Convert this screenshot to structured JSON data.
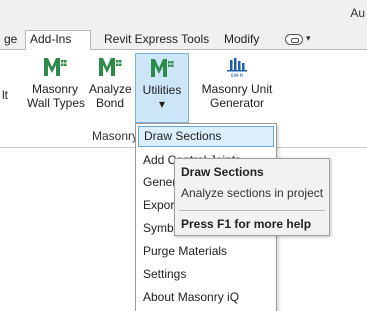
{
  "window": {
    "title": "Au"
  },
  "tabs": [
    "ge",
    "Add-Ins",
    "Revit Express Tools",
    "Modify"
  ],
  "tab_active_index": 1,
  "ribbon": {
    "left_stub": "lt",
    "buttons": [
      {
        "line1": "Masonry",
        "line2": "Wall Types",
        "icon": "masonry-iq-logo-icon"
      },
      {
        "line1": "Analyze",
        "line2": "Bond",
        "icon": "masonry-iq-logo-icon"
      },
      {
        "line1": "Utilities",
        "line2": "▾",
        "icon": "masonry-iq-logo-icon"
      },
      {
        "line1": "Masonry Unit",
        "line2": "Generator",
        "icon": "bim-m-icon"
      }
    ],
    "panel_label": "Masonry iQ",
    "bim_badge": "BIM-M"
  },
  "menu": {
    "items": [
      "Draw Sections",
      "Add Control Joints",
      "General",
      "Export",
      "Symbols",
      "Purge Materials",
      "Settings",
      "About Masonry iQ"
    ],
    "highlighted_index": 0
  },
  "tooltip": {
    "title": "Draw Sections",
    "description": "Analyze sections in project",
    "help": "Press F1 for more help"
  },
  "colors": {
    "logo_green": "#2d8a4a",
    "menu_highlight": "#dbeefb",
    "menu_highlight_border": "#66a7d9",
    "active_button_bg": "#cde6f7"
  }
}
